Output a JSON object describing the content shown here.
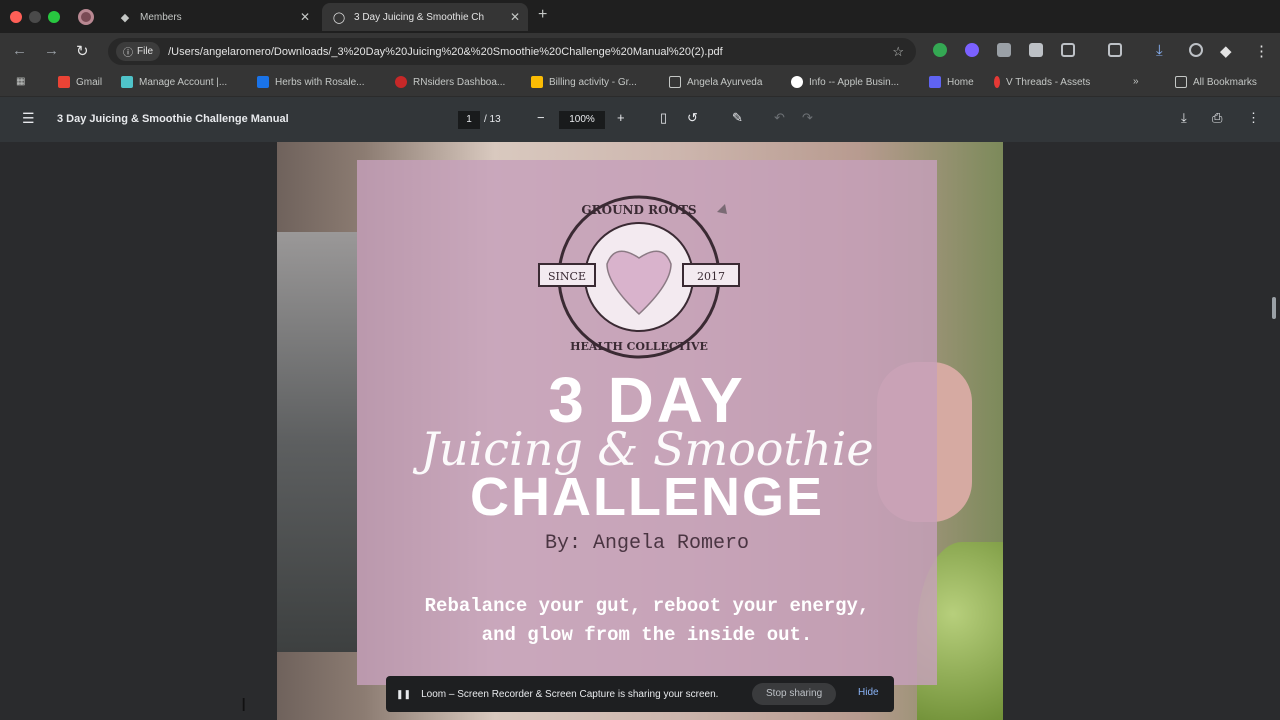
{
  "tabs": [
    {
      "title": "Members",
      "active": false
    },
    {
      "title": "3 Day Juicing & Smoothie Ch",
      "active": true
    }
  ],
  "omnibox": {
    "chip_label": "File",
    "url": "/Users/angelaromero/Downloads/_3%20Day%20Juicing%20&%20Smoothie%20Challenge%20Manual%20(2).pdf"
  },
  "bookmarks": [
    {
      "label": "Gmail",
      "icon_color": "#ea4335"
    },
    {
      "label": "Manage Account |...",
      "icon_color": "#4fc3c9"
    },
    {
      "label": "Herbs with Rosale...",
      "icon_color": "#1a73e8"
    },
    {
      "label": "RNsiders Dashboa...",
      "icon_color": "#c62828"
    },
    {
      "label": "Billing activity - Gr...",
      "icon_color": "#fbbc04"
    },
    {
      "label": "Angela Ayurveda",
      "icon_color": "folder"
    },
    {
      "label": "Info -- Apple Busin...",
      "icon_color": "#ffffff"
    },
    {
      "label": "Home",
      "icon_color": "#5f63f2"
    },
    {
      "label": "V Threads - Assets",
      "icon_color": "#e53935"
    },
    {
      "label": "All Bookmarks",
      "icon_color": "folder"
    }
  ],
  "pdf": {
    "title": "3 Day Juicing & Smoothie Challenge Manual",
    "page_current": "1",
    "page_total": "/ 13",
    "zoom": "100%"
  },
  "cover": {
    "logo_top": "GROUND ROOTS",
    "logo_left": "SINCE",
    "logo_right": "2017",
    "logo_bottom": "HEALTH COLLECTIVE",
    "title_line1": "3 DAY",
    "title_script": "Juicing & Smoothie",
    "title_line3": "CHALLENGE",
    "byline": "By: Angela Romero",
    "tagline_line1": "Rebalance your gut, reboot your energy,",
    "tagline_line2": "and glow from the inside out."
  },
  "share_bar": {
    "message": "Loom – Screen Recorder & Screen Capture is sharing your screen.",
    "stop_label": "Stop sharing",
    "hide_label": "Hide"
  },
  "colors": {
    "overlay": "#c6a0bb",
    "accent_link": "#8ab4f8"
  }
}
